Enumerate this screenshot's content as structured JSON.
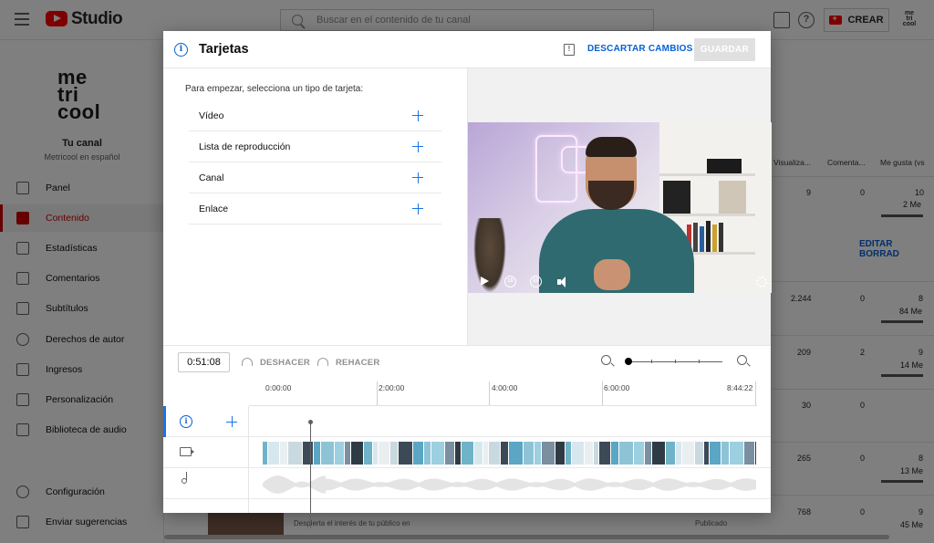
{
  "topbar": {
    "app_name": "Studio",
    "search_placeholder": "Buscar en el contenido de tu canal",
    "create_label": "CREAR",
    "avatar_text": "me tri cool"
  },
  "sidebar": {
    "logo_lines": [
      "me",
      "tri",
      "cool"
    ],
    "channel_title": "Tu canal",
    "channel_name": "Metricool en español",
    "items": [
      {
        "label": "Panel",
        "icon": "dashboard-icon"
      },
      {
        "label": "Contenido",
        "icon": "video-icon",
        "active": true
      },
      {
        "label": "Estadísticas",
        "icon": "analytics-icon"
      },
      {
        "label": "Comentarios",
        "icon": "comments-icon"
      },
      {
        "label": "Subtítulos",
        "icon": "subtitles-icon"
      },
      {
        "label": "Derechos de autor",
        "icon": "copyright-icon"
      },
      {
        "label": "Ingresos",
        "icon": "dollar-icon"
      },
      {
        "label": "Personalización",
        "icon": "magic-wand-icon"
      },
      {
        "label": "Biblioteca de audio",
        "icon": "audio-library-icon"
      },
      {
        "label": "Configuración",
        "icon": "gear-icon"
      },
      {
        "label": "Enviar sugerencias",
        "icon": "feedback-icon"
      }
    ]
  },
  "content_table": {
    "columns": [
      "Visualiza...",
      "Comenta...",
      "Me gusta (vs"
    ],
    "edit_drafts_label": "EDITAR BORRAD",
    "rows": [
      {
        "views": "9",
        "comments": "0",
        "likes": "10",
        "likes_sub": "2 Me"
      },
      {
        "views": "2.244",
        "comments": "0",
        "likes": "8",
        "likes_sub": "84 Me"
      },
      {
        "views": "209",
        "comments": "2",
        "likes": "9",
        "likes_sub": "14 Me"
      },
      {
        "views": "30",
        "comments": "0",
        "likes": "",
        "likes_sub": ""
      },
      {
        "views": "265",
        "comments": "0",
        "likes": "8",
        "likes_sub": "13 Me"
      },
      {
        "views": "768",
        "comments": "0",
        "likes": "9",
        "likes_sub": "45 Me"
      }
    ],
    "partial_description": "Despierta el interés de tu público en",
    "partial_status": "Publicado"
  },
  "modal": {
    "title": "Tarjetas",
    "discard_label": "DESCARTAR CAMBIOS",
    "save_label": "GUARDAR",
    "intro_text": "Para empezar, selecciona un tipo de tarjeta:",
    "card_types": [
      "Vídeo",
      "Lista de reproducción",
      "Canal",
      "Enlace"
    ],
    "timecode": "0:51:08",
    "undo_label": "DESHACER",
    "redo_label": "REHACER",
    "ruler_labels": [
      "0:00:00",
      "2:00:00",
      "4:00:00",
      "6:00:00",
      "8:44:22"
    ],
    "playhead_fraction": 0.097
  },
  "colors": {
    "accent_blue": "#065fd4",
    "youtube_red": "#ff0000",
    "active_red": "#cc0000"
  }
}
